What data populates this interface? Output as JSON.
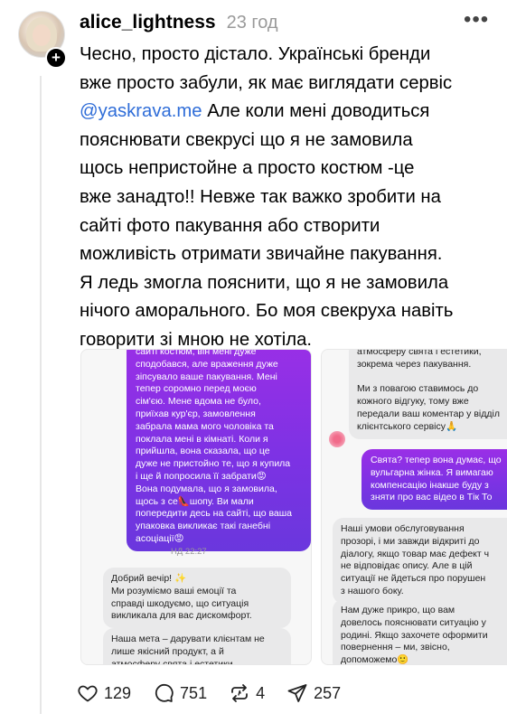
{
  "post": {
    "username": "alice_lightness",
    "time": "23 год",
    "more_icon": "more-horizontal-icon",
    "text_before_mention": "Чесно,  просто дістало. Українські бренди\nвже просто забули, як має виглядати сервіс\n",
    "mention": "@yaskrava.me",
    "text_after_mention": " Але коли мені доводиться\nпояснювати свекрусі що я не замовила\nщось непристойне а просто костюм -це\nвже занадто!! Невже так важко зробити на\nсайті фото пакування або створити\nможливість отримати звичайне пакування.\nЯ ледь змогла пояснити, що я не замовила\nнічого аморального. Бо моя свекруха навіть\nговорити зі мною не хотіла."
  },
  "screenshot_left": {
    "user_message": "сайті костюм, він мені дуже\nсподобався, але враження дуже\nзіпсувало ваше пакування. Мені\nтепер соромно перед моєю\nсім'єю. Мене вдома не було,\nприїхав кур'єр, замовлення\nзабрала мама мого чоловіка та\nпоклала мені в кімнаті. Коли я\nприйшла, вона сказала, що це\nдуже не пристойно те, що я купила\nі ще й попросила її забрати😡\nВона подумала, що я замовила,\nщось з се👠шопу. Ви мали\nпопередити десь на сайті, що ваша\nупаковка викликає такі ганебні\nасоціації😡",
    "timestamp": "НД 22:27",
    "reply_greeting": "Добрий вечір! ✨\nМи розуміємо ваші емоції та\nсправді шкодуємо, що ситуація\nвикликала для вас дискомфорт.",
    "reply_mission": "Наша мета – дарувати клієнтам не\nлише якісний продукт, а й\nатмосферу свята і естетики,"
  },
  "screenshot_right": {
    "reply_top": "атмосферу свята і естетики,\nзокрема через пакування.\n\nМи з повагою ставимось до\nкожного відгуку, тому вже\nпередали ваш коментар у відділ\nклієнтського сервісу🙏",
    "user_message": "Свята? тепер вона думає, що\nвульгарна жінка. Я вимагаю\nкомпенсацію інакше буду з\nзняти про вас відео в Тік То",
    "reply_terms": "Наші умови обслуговування\nпрозорі, і ми завжди відкриті до\nдіалогу, якщо товар має дефект ч\nне відповідає опису. Але в цій\nситуації не йдеться про порушен\nз нашого боку.",
    "reply_sorry": "Нам дуже прикро, що вам\nдовелось пояснювати ситуацію у\nродині. Якщо захочете оформити\nповернення – ми, звісно,\nдопоможемо🙂"
  },
  "actions": {
    "likes": "129",
    "comments": "751",
    "reposts": "4",
    "shares": "257"
  }
}
